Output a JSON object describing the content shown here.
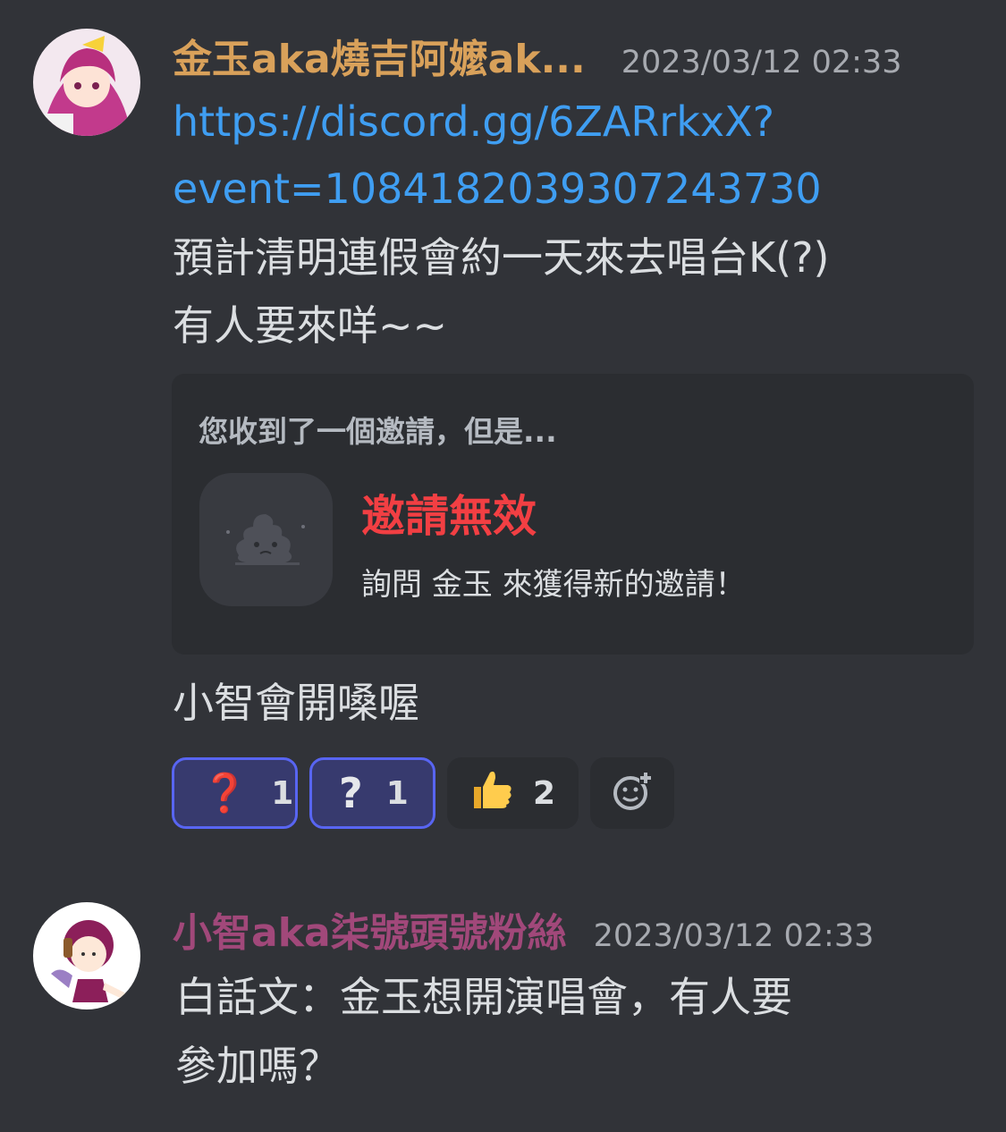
{
  "messages": [
    {
      "username": "金玉aka燒吉阿嬤ak...",
      "username_color": "#d9a15a",
      "timestamp": "2023/03/12 02:33",
      "lines": [
        "https://discord.gg/6ZARrkxX?",
        "event=1084182039307243730",
        "預計清明連假會約一天來去唱台K(?)",
        "有人要來咩~~"
      ],
      "invite": {
        "header": "您收到了一個邀請，但是...",
        "title": "邀請無效",
        "subtitle": "詢問 金玉 來獲得新的邀請！",
        "icon": "poop-icon"
      },
      "after_text": "小智會開嗓喔",
      "reactions": [
        {
          "emoji": "❓",
          "count": "1",
          "active": true,
          "color": "#dd2e44"
        },
        {
          "emoji": "?",
          "count": "1",
          "active": true,
          "color": "#e6e8eb"
        },
        {
          "emoji": "👍",
          "count": "2",
          "active": false
        },
        {
          "emoji": "add-reaction-icon",
          "count": "",
          "active": false
        }
      ]
    },
    {
      "username": "小智aka柒號頭號粉絲",
      "username_color": "#a1487a",
      "timestamp": "2023/03/12 02:33",
      "lines": [
        "白話文：金玉想開演唱會，有人要",
        "參加嗎？"
      ]
    }
  ]
}
